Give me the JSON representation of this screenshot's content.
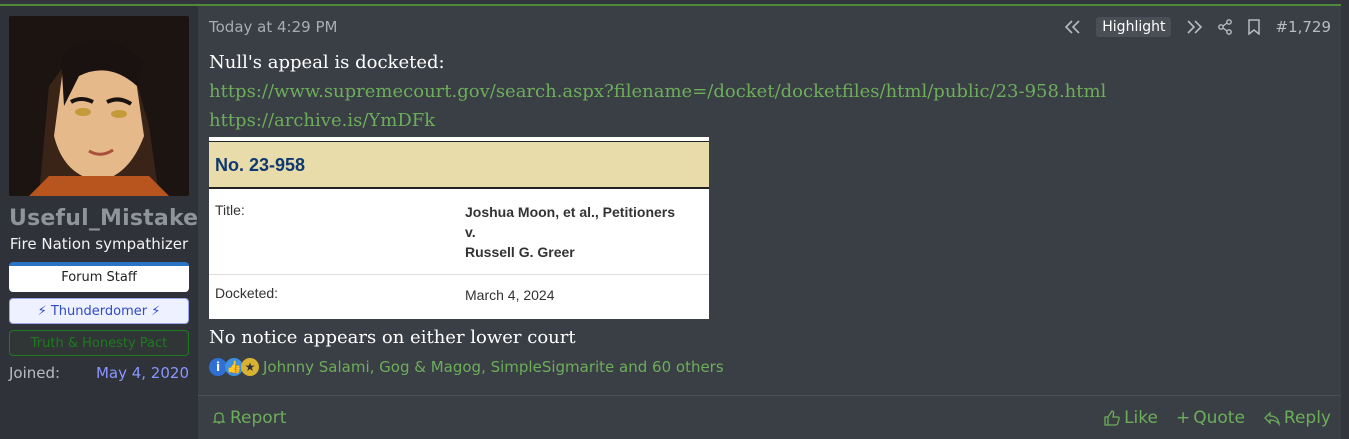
{
  "user": {
    "name": "Useful_Mistake",
    "title": "Fire Nation sympathizer",
    "banners": [
      "Forum Staff",
      "⚡ Thunderdomer ⚡",
      "Truth & Honesty Pact"
    ],
    "joined_label": "Joined:",
    "joined_value": "May 4, 2020"
  },
  "header": {
    "timestamp": "Today at 4:29 PM",
    "highlight_label": "Highlight",
    "post_number": "#1,729"
  },
  "body": {
    "intro": "Null's appeal is docketed:",
    "link1": "https://www.supremecourt.gov/search.aspx?filename=/docket/docketfiles/html/public/23-958.html",
    "link2": "https://archive.is/YmDFk",
    "outro": "No notice appears on either lower court"
  },
  "docket": {
    "number": "No. 23-958",
    "title_label": "Title:",
    "title_line1": "Joshua Moon, et al., Petitioners",
    "title_line2": "v.",
    "title_line3": "Russell G. Greer",
    "docketed_label": "Docketed:",
    "docketed_value": "March 4, 2024"
  },
  "reactions": {
    "icons": [
      "info-icon",
      "like-icon",
      "medal-icon"
    ],
    "text": "Johnny Salami, Gog & Magog, SimpleSigmarite and 60 others"
  },
  "footer": {
    "report": "Report",
    "like": "Like",
    "quote": "Quote",
    "reply": "Reply"
  },
  "colors": {
    "accent_green": "#6dae5a",
    "background": "#3a3e45",
    "sidebar": "#2f3238",
    "joined_value": "#8a96ff"
  }
}
